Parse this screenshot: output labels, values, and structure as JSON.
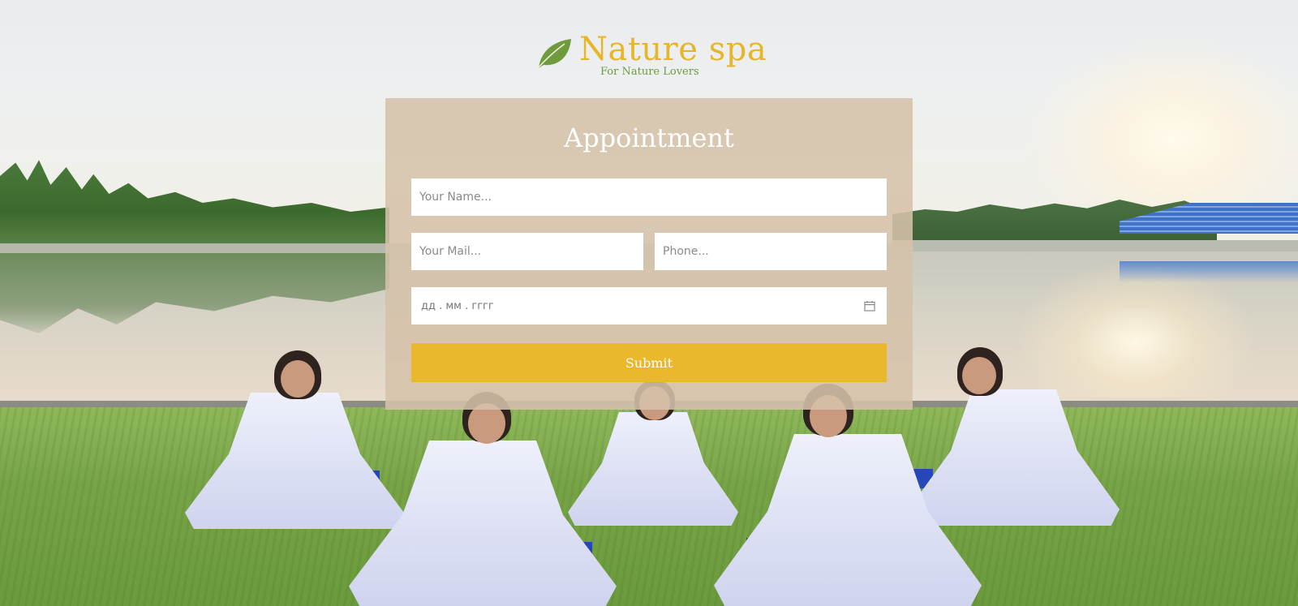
{
  "brand": {
    "name": "Nature spa",
    "tagline": "For Nature Lovers",
    "logo_icon": "leaf-icon",
    "colors": {
      "name": "#e6b628",
      "tagline": "#6f9b3c",
      "leaf": "#6f9b3c"
    }
  },
  "form": {
    "title": "Appointment",
    "name_placeholder": "Your Name...",
    "mail_placeholder": "Your Mail...",
    "phone_placeholder": "Phone...",
    "date_placeholder": "дд . мм . гггг",
    "date_icon": "calendar-icon",
    "submit_label": "Submit",
    "colors": {
      "submit": "#e9b92b",
      "panel": "#d5c2aa"
    }
  },
  "background": {
    "scene": "meditation by the lake"
  }
}
